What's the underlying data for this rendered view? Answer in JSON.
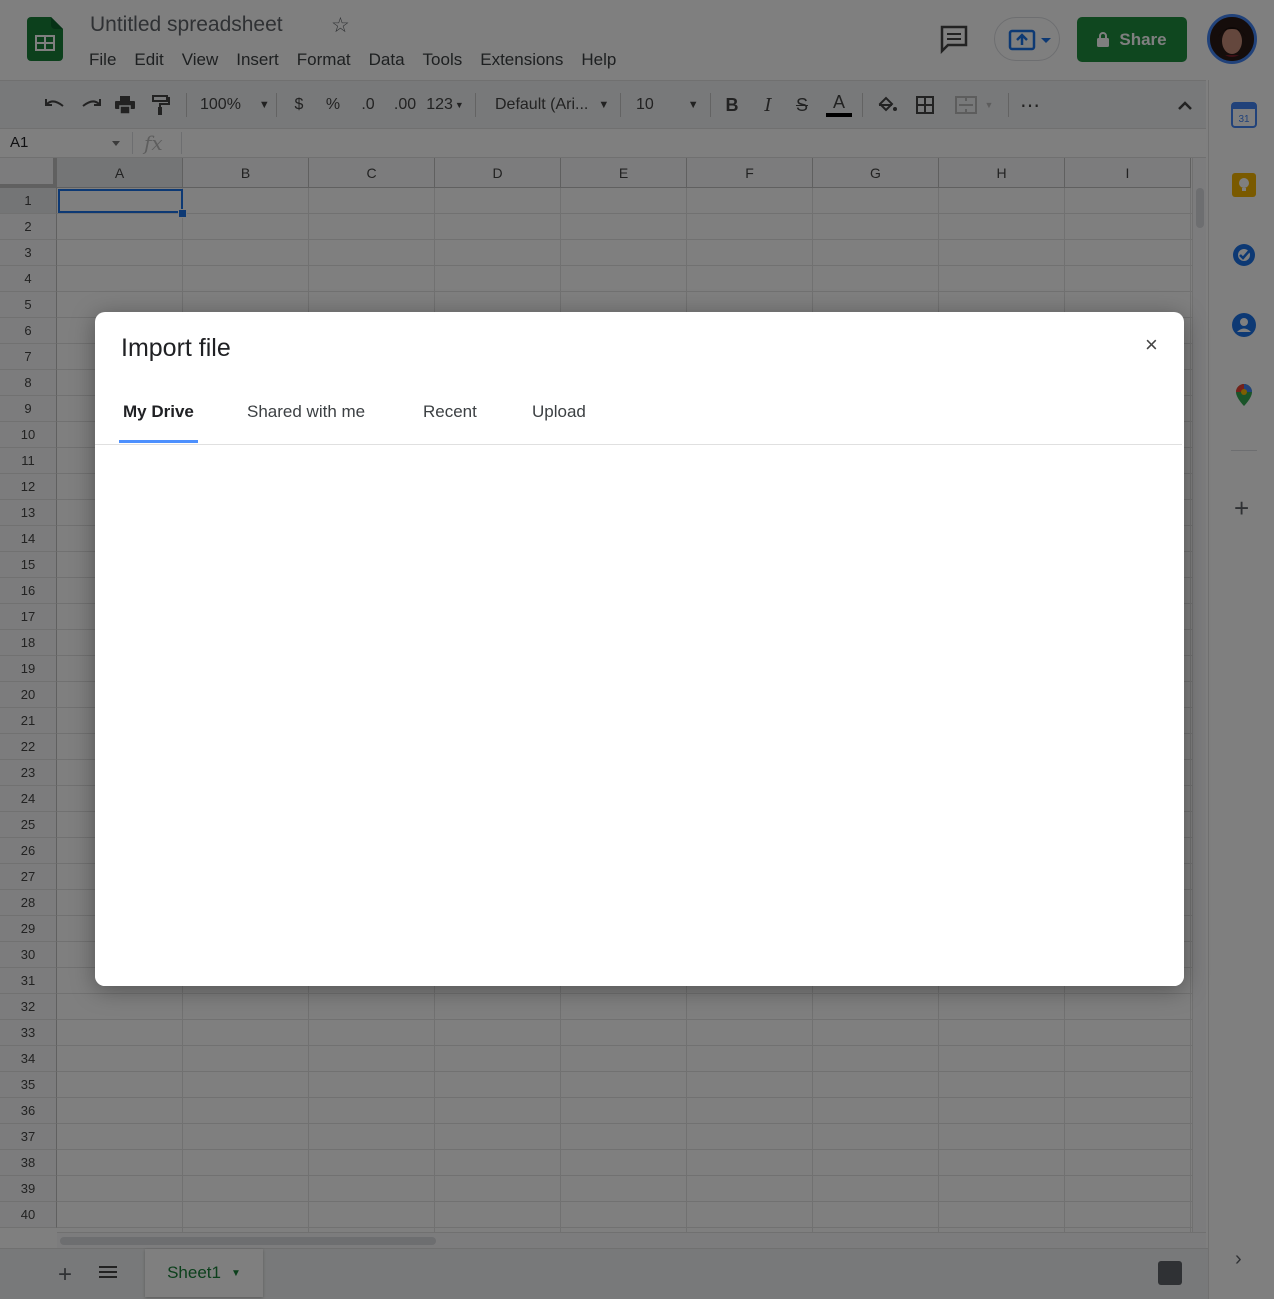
{
  "app": {
    "title": "Untitled spreadsheet",
    "menu": [
      "File",
      "Edit",
      "View",
      "Insert",
      "Format",
      "Data",
      "Tools",
      "Extensions",
      "Help"
    ],
    "share_label": "Share"
  },
  "toolbar": {
    "zoom": "100%",
    "currency": "$",
    "percent": "%",
    "decrease_decimal": ".0",
    "increase_decimal": ".00",
    "number_format": "123",
    "font": "Default (Ari...",
    "font_size": "10",
    "bold": "B",
    "italic": "I",
    "strikethrough": "S",
    "text_color": "A",
    "more": "⋯"
  },
  "formula_bar": {
    "cell_ref": "A1",
    "fx_label": "fx"
  },
  "grid": {
    "columns": [
      "A",
      "B",
      "C",
      "D",
      "E",
      "F",
      "G",
      "H",
      "I"
    ],
    "rows": [
      "1",
      "2",
      "3",
      "4",
      "5",
      "6",
      "7",
      "8",
      "9",
      "10",
      "11",
      "12",
      "13",
      "14",
      "15",
      "16",
      "17",
      "18",
      "19",
      "20",
      "21",
      "22",
      "23",
      "24",
      "25",
      "26",
      "27",
      "28",
      "29",
      "30",
      "31",
      "32",
      "33",
      "34",
      "35",
      "36",
      "37",
      "38",
      "39",
      "40"
    ]
  },
  "sheets": {
    "tabs": [
      "Sheet1"
    ]
  },
  "dialog": {
    "title": "Import file",
    "close": "×",
    "tabs": [
      "My Drive",
      "Shared with me",
      "Recent",
      "Upload"
    ],
    "active_tab": "My Drive"
  },
  "colors": {
    "share_green": "#1e8e3e",
    "selection_blue": "#1a73e8",
    "tab_underline": "#4d90fe",
    "sheet_tab_green": "#188038"
  },
  "icons": [
    "sheets-logo-icon",
    "star-icon",
    "comments-icon",
    "present-icon",
    "lock-icon",
    "undo-icon",
    "redo-icon",
    "print-icon",
    "paint-format-icon",
    "fill-color-icon",
    "borders-icon",
    "merge-cells-icon",
    "collapse-icon",
    "calendar-icon",
    "keep-icon",
    "tasks-icon",
    "contacts-icon",
    "maps-icon",
    "add-icon",
    "chevron-right-icon",
    "all-sheets-icon",
    "explore-icon"
  ]
}
